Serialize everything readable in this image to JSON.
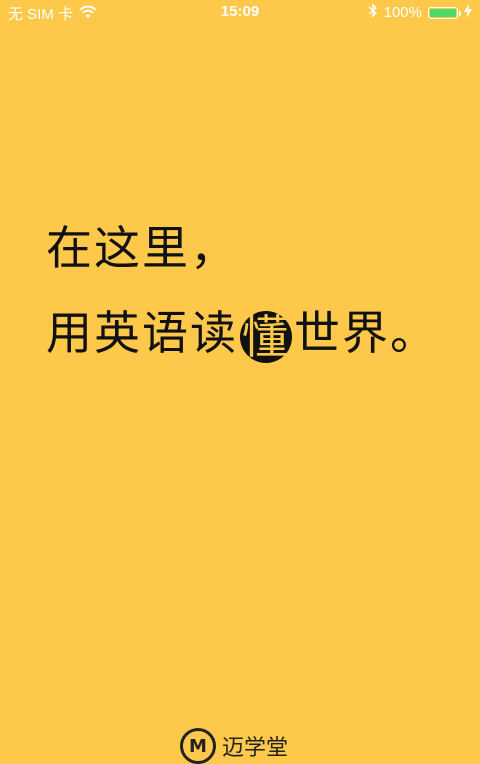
{
  "status_bar": {
    "carrier": "无 SIM 卡",
    "time": "15:09",
    "battery_percent": "100%",
    "battery_level": 1.0,
    "icons": [
      "wifi-icon",
      "bluetooth-icon",
      "battery-icon",
      "charging-icon"
    ]
  },
  "splash": {
    "line1": "在这里，",
    "line2_before": "用英语读",
    "line2_highlight": "懂",
    "line2_after": "世界。"
  },
  "brand": {
    "logo_letter": "M",
    "name": "迈学堂"
  },
  "colors": {
    "background": "#FEC94B",
    "text": "#111111",
    "battery": "#4CD964"
  }
}
